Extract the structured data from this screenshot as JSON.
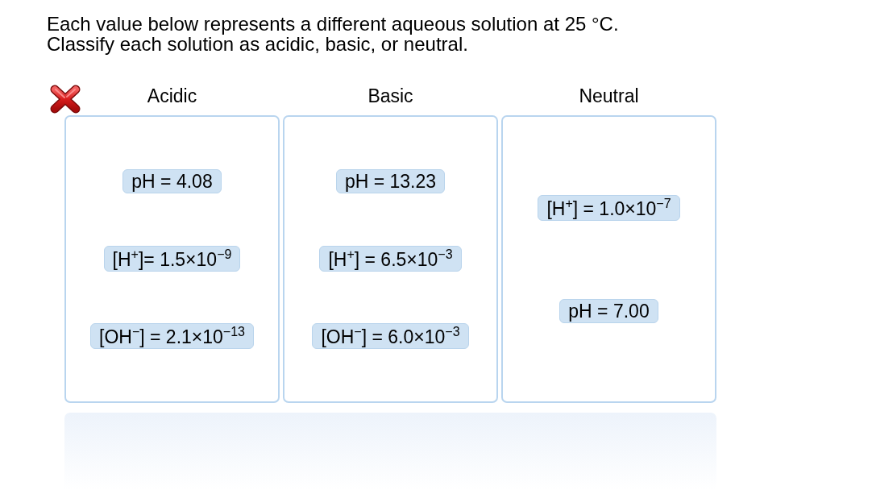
{
  "instructions": [
    "Each value below represents a different aqueous solution at 25 °C.",
    "Classify each solution as acidic, basic, or neutral."
  ],
  "result": {
    "correct": false
  },
  "bins": [
    {
      "label": "Acidic",
      "items": [
        "pH = 4.08",
        "[H$^{+}$]= 1.5×10$^{−9}$",
        "[OH$^{−}$] = 2.1×10$^{−13}$"
      ]
    },
    {
      "label": "Basic",
      "items": [
        "pH = 13.23",
        "[H$^{+}$] = 6.5×10$^{−3}$",
        "[OH$^{−}$] = 6.0×10$^{−3}$"
      ]
    },
    {
      "label": "Neutral",
      "items": [
        "[H$^{+}$] = 1.0×10$^{−7}$",
        "pH = 7.00"
      ]
    }
  ]
}
